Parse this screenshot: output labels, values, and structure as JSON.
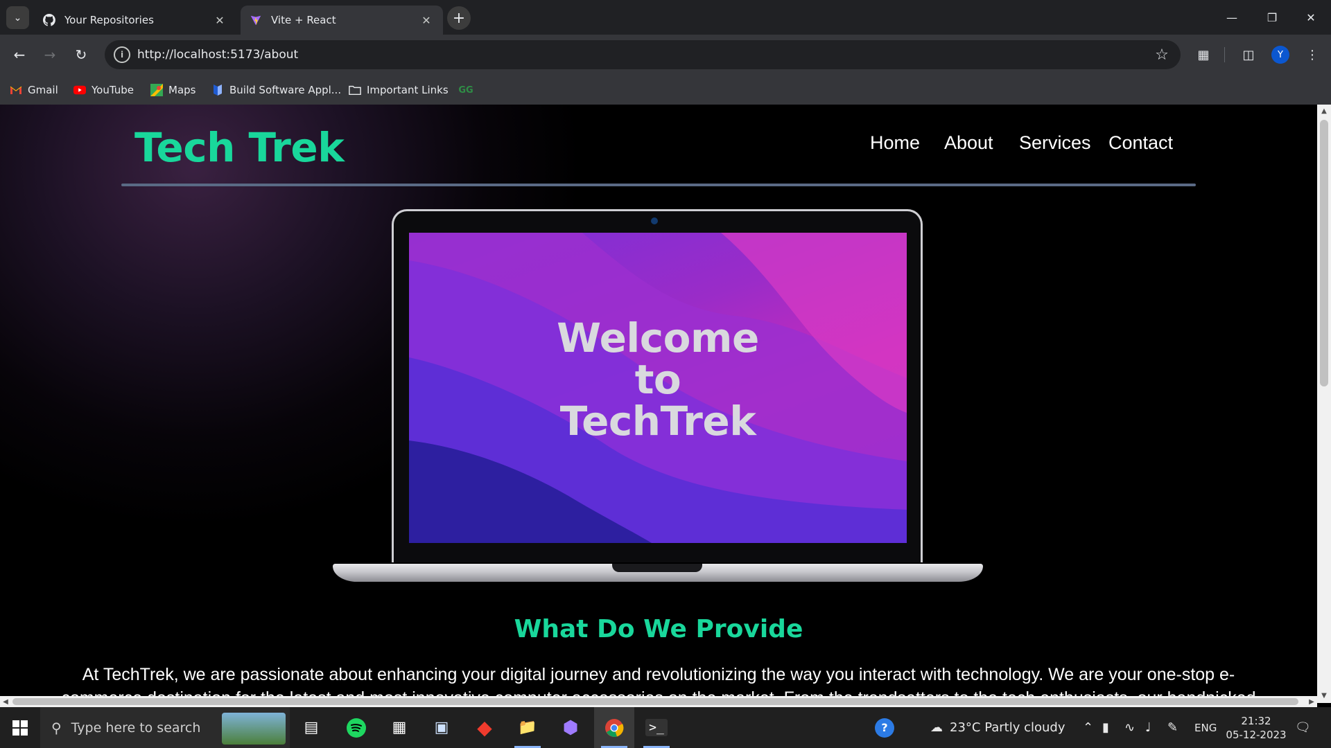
{
  "browser": {
    "tabs": [
      {
        "title": "Your Repositories",
        "icon": "github-icon",
        "active": false
      },
      {
        "title": "Vite + React",
        "icon": "vite-icon",
        "active": true
      }
    ],
    "url": "http://localhost:5173/about",
    "bookmarks": [
      {
        "label": "Gmail",
        "icon": "gmail-icon"
      },
      {
        "label": "YouTube",
        "icon": "youtube-icon"
      },
      {
        "label": "Maps",
        "icon": "maps-icon"
      },
      {
        "label": "Build Software Appl...",
        "icon": "app-icon"
      },
      {
        "label": "Important Links",
        "icon": "folder-icon"
      }
    ],
    "profile_initial": "Y"
  },
  "page": {
    "brand": "Tech Trek",
    "nav": [
      "Home",
      "About",
      "Services",
      "Contact"
    ],
    "hero_text": [
      "Welcome",
      "to",
      "TechTrek"
    ],
    "section_title": "What Do We Provide",
    "paragraph": "At TechTrek, we are passionate about enhancing your digital journey and revolutionizing the way you interact with technology. We are your one-stop e-commerce destination for the latest and most innovative computer accessories on the market. From the trendsetters to the tech enthusiasts, our handpicked"
  },
  "taskbar": {
    "search_placeholder": "Type here to search",
    "weather": "23°C  Partly cloudy",
    "language": "ENG",
    "time": "21:32",
    "date": "05-12-2023"
  },
  "colors": {
    "accent_green": "#19d79b",
    "nav_rule": "#5a6a85"
  }
}
